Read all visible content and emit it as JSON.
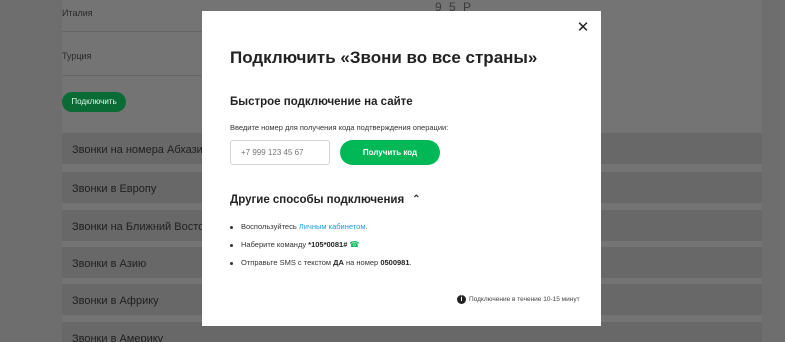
{
  "background": {
    "countries": [
      "Италия",
      "Турция"
    ],
    "price_partial": "9 5 Р",
    "connect_label": "Подключить",
    "accordion": [
      "Звонки на номера Абхазии, Южной Осетии",
      "Звонки в Европу",
      "Звонки на Ближний Восток",
      "Звонки в Азию",
      "Звонки в Африку",
      "Звонки в Америку"
    ]
  },
  "modal": {
    "title": "Подключить «Звони во все страны»",
    "quick": {
      "heading": "Быстрое подключение на сайте",
      "hint": "Введите номер для получения кода подтверждения операции:",
      "phone_placeholder": "+7 999 123 45 67",
      "button": "Получить код"
    },
    "other": {
      "heading": "Другие способы подключения",
      "items": {
        "i1_pre": "Воспользуйтесь ",
        "i1_link": "Личным кабинетом",
        "i1_post": ".",
        "i2_pre": "Наберите команду ",
        "i2_code": "*105*0081#",
        "i3_pre": "Отправьте SMS с текстом ",
        "i3_text": "ДА",
        "i3_mid": " на номер ",
        "i3_number": "0500981",
        "i3_post": "."
      }
    },
    "note": "Подключение в течение 10-15 минут",
    "close_symbol": "✕"
  },
  "colors": {
    "accent": "#00b956",
    "link": "#1a9ed8",
    "overlay": "#6f6f6f"
  }
}
